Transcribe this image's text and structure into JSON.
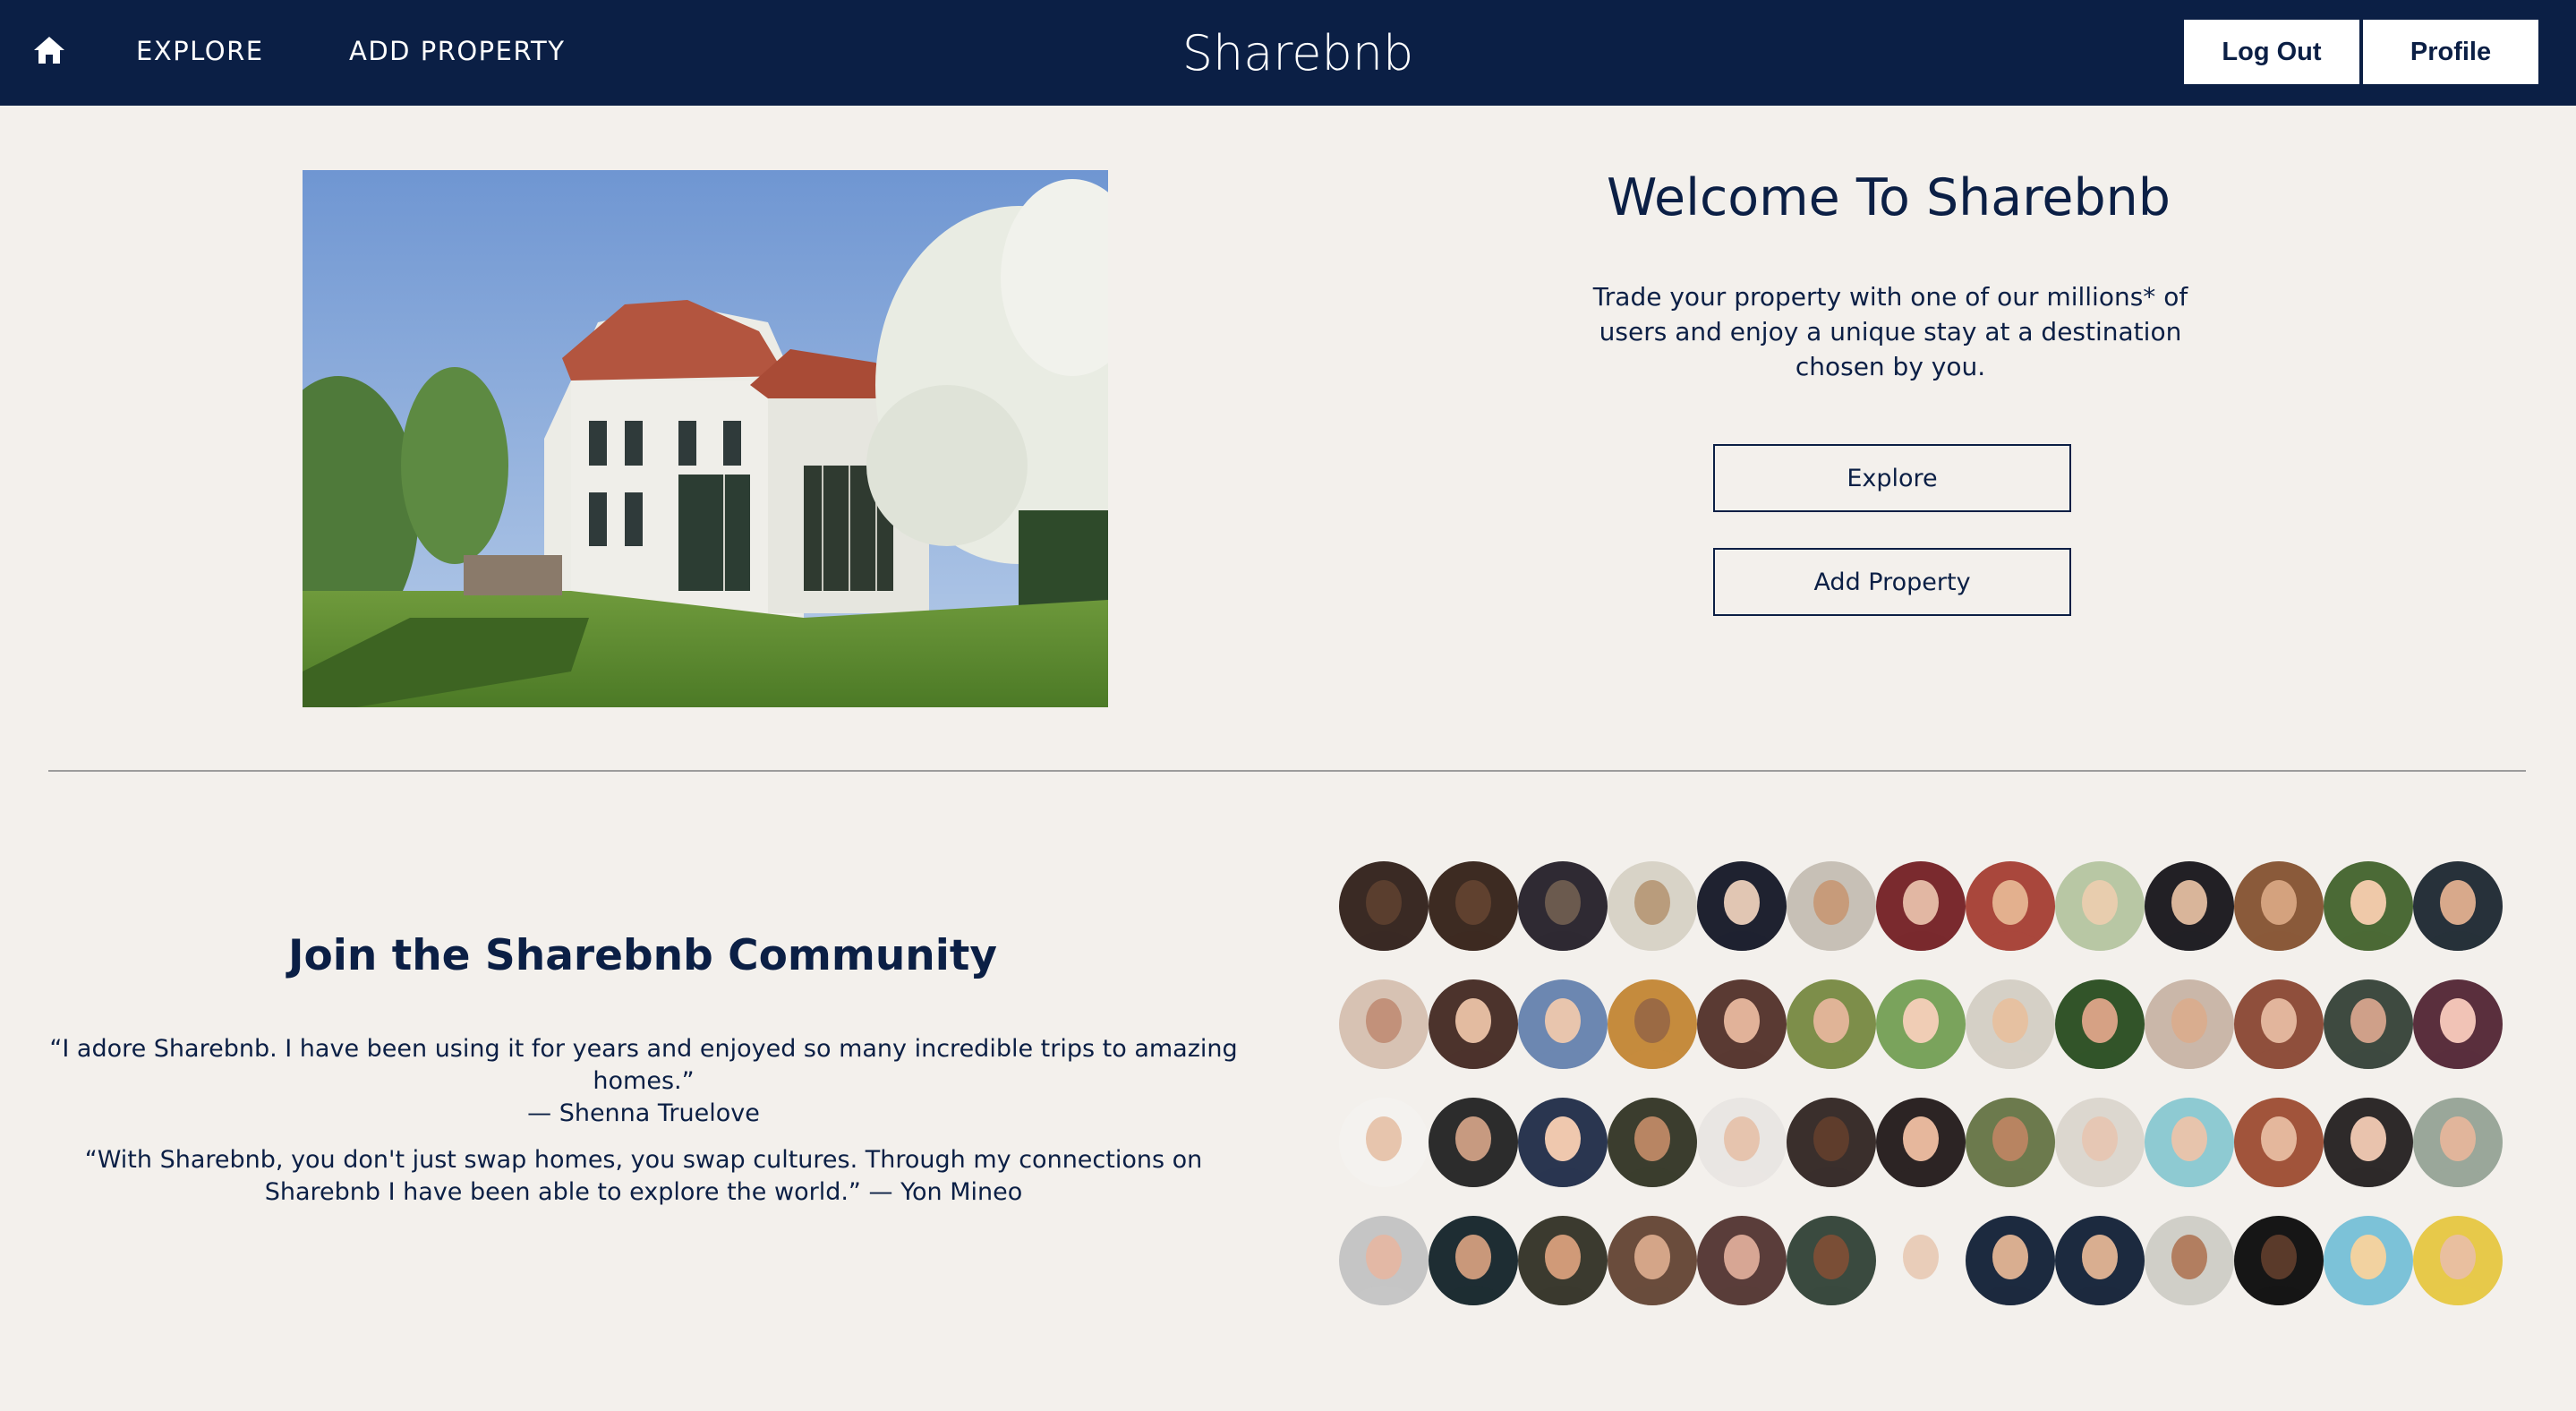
{
  "nav": {
    "home_icon": "home-icon",
    "explore_label": "EXPLORE",
    "add_property_label": "ADD PROPERTY",
    "brand": "Sharebnb",
    "logout_label": "Log Out",
    "profile_label": "Profile"
  },
  "hero": {
    "title": "Welcome To Sharebnb",
    "description": "Trade your property with one of our millions* of users and enjoy a unique stay at a destination chosen by you.",
    "explore_button": "Explore",
    "add_property_button": "Add Property"
  },
  "community": {
    "title": "Join the Sharebnb Community",
    "quotes": [
      {
        "text": "“I adore Sharebnb. I have been using it for years and enjoyed so many incredible trips to amazing homes.”",
        "author": "— Shenna Truelove"
      },
      {
        "text": "“With Sharebnb, you don't just swap homes, you swap cultures. Through my connections on Sharebnb I have been able to explore the world.”",
        "author": "— Yon Mineo"
      }
    ]
  },
  "colors": {
    "navy": "#0b1f45",
    "background": "#f3f0ec",
    "divider": "#9c9c9c"
  },
  "avatar_palette": [
    [
      "#3a2a24",
      "#5a3e2e"
    ],
    [
      "#3d2b22",
      "#60412f"
    ],
    [
      "#2f2a33",
      "#6b5a4e"
    ],
    [
      "#d8d3c7",
      "#b99c7c"
    ],
    [
      "#1f2230",
      "#e1c6b3"
    ],
    [
      "#c7c0b6",
      "#c79b7a"
    ],
    [
      "#7a2a2e",
      "#e2b7a3"
    ],
    [
      "#a9473c",
      "#e3b08e"
    ],
    [
      "#b8c7a4",
      "#e8cdae"
    ],
    [
      "#222025",
      "#d9b59a"
    ],
    [
      "#8a5a3a",
      "#d4a27e"
    ],
    [
      "#4b6a36",
      "#efc9a9"
    ],
    [
      "#27313a",
      "#d8a98b"
    ],
    [
      "#d7c2b3",
      "#c2917a"
    ],
    [
      "#4c332c",
      "#e3bba0"
    ],
    [
      "#6c87b1",
      "#e8c5ad"
    ],
    [
      "#c58b3d",
      "#9b6a44"
    ],
    [
      "#5a3a33",
      "#e1b299"
    ],
    [
      "#7d8e4a",
      "#e0b497"
    ],
    [
      "#7aa35c",
      "#f0cdb5"
    ],
    [
      "#d5d0c6",
      "#e6c1a1"
    ],
    [
      "#325429",
      "#d6a184"
    ],
    [
      "#cab7a9",
      "#d9ad8f"
    ],
    [
      "#8f4f3c",
      "#e2b59c"
    ],
    [
      "#3e4a40",
      "#cfa089"
    ],
    [
      "#5a2f3d",
      "#f1c3b6"
    ],
    [
      "#f4f2ef",
      "#e7c5ad"
    ],
    [
      "#2c2c2c",
      "#c79a80"
    ],
    [
      "#2a3650",
      "#efc8ae"
    ],
    [
      "#3b3d2e",
      "#b88563"
    ],
    [
      "#e9e6e3",
      "#e6c4ae"
    ],
    [
      "#3a2f2c",
      "#5f3d2c"
    ],
    [
      "#2c2424",
      "#e6b79c"
    ],
    [
      "#6c7a4d",
      "#b88461"
    ],
    [
      "#dcd7cf",
      "#e6c7b4"
    ],
    [
      "#8ecad2",
      "#e7c4ac"
    ],
    [
      "#a1543b",
      "#e4b79c"
    ],
    [
      "#2e2a2a",
      "#e9c3ad"
    ],
    [
      "#9aa79a",
      "#e1b59b"
    ],
    [
      "#c5c5c5",
      "#e3b8a5"
    ],
    [
      "#1e2d33",
      "#c9987a"
    ],
    [
      "#3b3a2f",
      "#d09a78"
    ],
    [
      "#6a4c3c",
      "#d4a588"
    ],
    [
      "#5a3d3a",
      "#d7a694"
    ],
    [
      "#3a4a3f",
      "#7a4e36"
    ],
    [
      "#f3f0ec",
      "#e9cdb9"
    ],
    [
      "#1c2a3f",
      "#d9ae90"
    ],
    [
      "#1c2a3f",
      "#d9ae90"
    ],
    [
      "#d0cfc8",
      "#b27e60"
    ],
    [
      "#161616",
      "#5a3a2a"
    ],
    [
      "#7cc2d8",
      "#f2d2a0"
    ],
    [
      "#e7c94a",
      "#e9bf9f"
    ]
  ]
}
